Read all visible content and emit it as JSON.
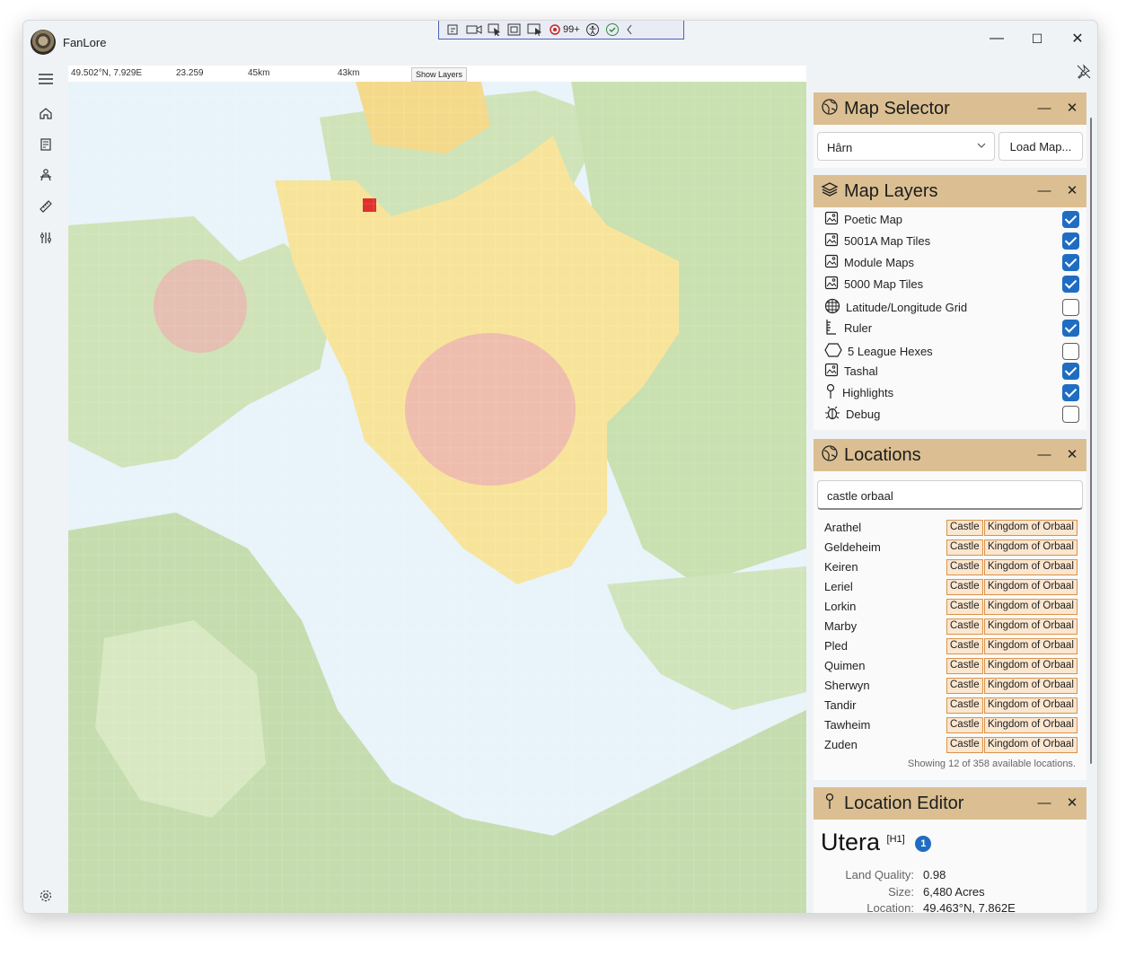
{
  "app": {
    "title": "FanLore"
  },
  "window_controls": {
    "minimize": "—",
    "maximize": "☐",
    "close": "✕"
  },
  "debug_toolbar": {
    "badge": "99+"
  },
  "nav": {
    "items": [
      "menu-icon",
      "home-icon",
      "notes-icon",
      "character-icon",
      "ruler-icon",
      "tools-icon",
      "settings-icon"
    ]
  },
  "map_info": {
    "coords": "49.502°N, 7.929E",
    "value": "23.259",
    "dist1": "45km",
    "dist2": "43km",
    "show_layers": "Show Layers"
  },
  "map_selector": {
    "title": "Map Selector",
    "selected": "Hârn",
    "load_button": "Load Map..."
  },
  "map_layers": {
    "title": "Map Layers",
    "items": [
      {
        "label": "Poetic Map",
        "checked": true,
        "icon": "image-icon"
      },
      {
        "label": "5001A Map Tiles",
        "checked": true,
        "icon": "image-icon"
      },
      {
        "label": "Module Maps",
        "checked": true,
        "icon": "image-icon"
      },
      {
        "label": "5000 Map Tiles",
        "checked": true,
        "icon": "image-icon"
      },
      {
        "label": "Latitude/Longitude Grid",
        "checked": false,
        "icon": "grid-icon"
      },
      {
        "label": "Ruler",
        "checked": true,
        "icon": "ruler-icon"
      },
      {
        "label": "5 League Hexes",
        "checked": false,
        "icon": "hex-icon"
      },
      {
        "label": "Tashal",
        "checked": true,
        "icon": "image-icon"
      },
      {
        "label": "Highlights",
        "checked": true,
        "icon": "pin-icon"
      },
      {
        "label": "Debug",
        "checked": false,
        "icon": "bug-icon"
      }
    ]
  },
  "locations": {
    "title": "Locations",
    "search_value": "castle orbaal",
    "rows": [
      {
        "name": "Arathel",
        "type": "Castle",
        "realm": "Kingdom of Orbaal"
      },
      {
        "name": "Geldeheim",
        "type": "Castle",
        "realm": "Kingdom of Orbaal"
      },
      {
        "name": "Keiren",
        "type": "Castle",
        "realm": "Kingdom of Orbaal"
      },
      {
        "name": "Leriel",
        "type": "Castle",
        "realm": "Kingdom of Orbaal"
      },
      {
        "name": "Lorkin",
        "type": "Castle",
        "realm": "Kingdom of Orbaal"
      },
      {
        "name": "Marby",
        "type": "Castle",
        "realm": "Kingdom of Orbaal"
      },
      {
        "name": "Pled",
        "type": "Castle",
        "realm": "Kingdom of Orbaal"
      },
      {
        "name": "Quimen",
        "type": "Castle",
        "realm": "Kingdom of Orbaal"
      },
      {
        "name": "Sherwyn",
        "type": "Castle",
        "realm": "Kingdom of Orbaal"
      },
      {
        "name": "Tandir",
        "type": "Castle",
        "realm": "Kingdom of Orbaal"
      },
      {
        "name": "Tawheim",
        "type": "Castle",
        "realm": "Kingdom of Orbaal"
      },
      {
        "name": "Zuden",
        "type": "Castle",
        "realm": "Kingdom of Orbaal"
      }
    ],
    "showing": "Showing 12 of 358 available locations."
  },
  "location_editor": {
    "title": "Location Editor",
    "name": "Utera",
    "code": "[H1]",
    "info": "1",
    "fields": [
      {
        "key": "Land Quality:",
        "value": "0.98"
      },
      {
        "key": "Size:",
        "value": "6,480 Acres"
      },
      {
        "key": "Location:",
        "value": "49.463°N, 7.862E"
      }
    ]
  },
  "colors": {
    "panel_header": "#dbbf92",
    "checkbox_on": "#1f6dc2",
    "tag_border": "#d9934a",
    "tag_fill": "#fbe6cf"
  }
}
